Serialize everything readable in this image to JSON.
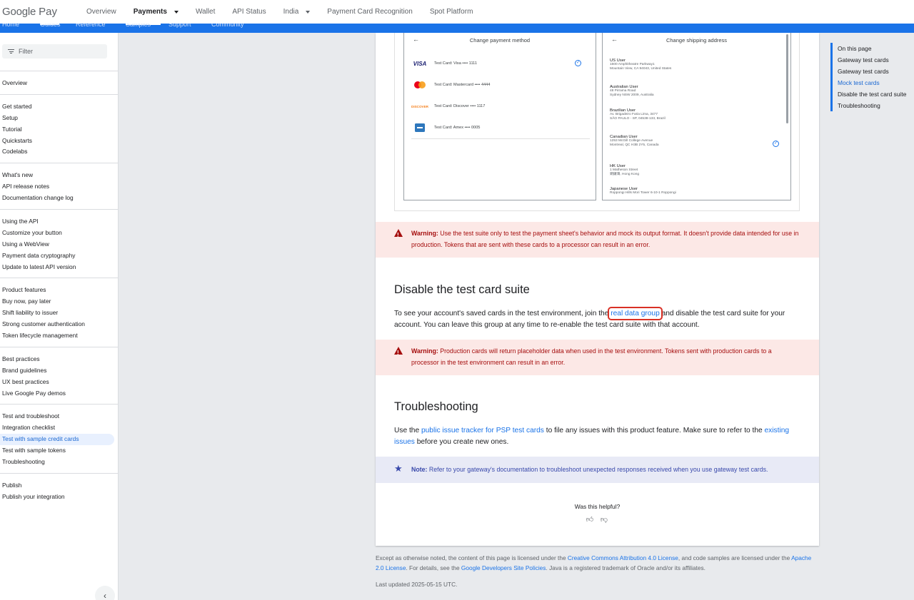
{
  "header": {
    "logo_google": "Google",
    "logo_pay": "Pay",
    "nav": [
      {
        "label": "Overview",
        "active": false,
        "dropdown": false
      },
      {
        "label": "Payments",
        "active": true,
        "dropdown": true
      },
      {
        "label": "Wallet",
        "active": false,
        "dropdown": false
      },
      {
        "label": "API Status",
        "active": false,
        "dropdown": false
      },
      {
        "label": "India",
        "active": false,
        "dropdown": true
      },
      {
        "label": "Payment Card Recognition",
        "active": false,
        "dropdown": false
      },
      {
        "label": "Spot Platform",
        "active": false,
        "dropdown": false
      }
    ],
    "subtabs": [
      "Home",
      "Guides",
      "Reference",
      "Samples",
      "Support",
      "Community"
    ]
  },
  "sidebar": {
    "filter_placeholder": "Filter",
    "groups": [
      {
        "items": [
          "Overview"
        ]
      },
      {
        "heading": "Get started",
        "items": [
          "Setup",
          "Tutorial",
          "Quickstarts",
          "Codelabs"
        ]
      },
      {
        "heading": "What's new",
        "items": [
          "API release notes",
          "Documentation change log"
        ]
      },
      {
        "heading": "Using the API",
        "items": [
          "Customize your button",
          "Using a WebView",
          "Payment data cryptography",
          "Update to latest API version"
        ]
      },
      {
        "heading": "Product features",
        "items": [
          "Buy now, pay later",
          "Shift liability to issuer",
          "Strong customer authentication",
          "Token lifecycle management"
        ]
      },
      {
        "heading": "Best practices",
        "items": [
          "Brand guidelines",
          "UX best practices",
          "Live Google Pay demos"
        ]
      },
      {
        "heading": "Test and troubleshoot",
        "items": [
          "Integration checklist",
          "Test with sample credit cards",
          "Test with sample tokens",
          "Troubleshooting"
        ],
        "selected": "Test with sample credit cards"
      },
      {
        "heading": "Publish",
        "items": [
          "Publish your integration"
        ]
      }
    ],
    "collapse_icon": "chevron-left-icon"
  },
  "figure": {
    "left_title": "Change payment method",
    "right_title": "Change shipping address",
    "cards": [
      {
        "brand": "VISA",
        "text": "Test Card: Visa •••• 1111",
        "color": "#1a1f71",
        "checked": true
      },
      {
        "brand": "MC",
        "text": "Test Card: Mastercard •••• 4444",
        "color": "#eb001b",
        "checked": false
      },
      {
        "brand": "DISCOVER",
        "text": "Test Card: Discover •••• 1117",
        "color": "#f58220",
        "checked": false
      },
      {
        "brand": "AMEX",
        "text": "Test Card: Amex •••• 0005",
        "color": "#2e77bc",
        "checked": false
      }
    ],
    "addresses": [
      {
        "name": "US User",
        "lines": [
          "1600 Amphitheatre Parkway1",
          "Mountain View, CA 94043, United States"
        ]
      },
      {
        "name": "Australian User",
        "lines": [
          "48 Pirrama Road",
          "Sydney NSW 2009, Australia"
        ]
      },
      {
        "name": "Brazilian User",
        "lines": [
          "Av. Brigadeiro Faria Lima, 3477",
          "SÃO PAULO - SP, 04538-133, Brazil"
        ]
      },
      {
        "name": "Canadian User",
        "lines": [
          "1253 McGill College Avenue",
          "Montreal, QC H3B 2Y5, Canada"
        ],
        "checked": true
      },
      {
        "name": "HK User",
        "lines": [
          "1 Matheson Street",
          "銅鑼灣, Hong Kong"
        ]
      },
      {
        "name": "Japanese User",
        "lines": [
          "Roppongi Hills Mori Tower 6-10-1 Roppongi"
        ]
      }
    ]
  },
  "warning1": {
    "label": "Warning:",
    "text": " Use the test suite only to test the payment sheet's behavior and mock its output format. It doesn't provide data intended for use in production. Tokens that are sent with these cards to a processor can result in an error."
  },
  "section_disable": {
    "title": "Disable the test card suite",
    "text_before": "To see your account's saved cards in the test environment, join the ",
    "link": "real data group",
    "text_after": " and disable the test card suite for your account. You can leave this group at any time to re-enable the test card suite with that account."
  },
  "warning2": {
    "label": "Warning:",
    "text": " Production cards will return placeholder data when used in the test environment. Tokens sent with production cards to a processor in the test environment can result in an error."
  },
  "section_trouble": {
    "title": "Troubleshooting",
    "text1": "Use the ",
    "link1": "public issue tracker for PSP test cards",
    "text2": " to file any issues with this product feature. Make sure to refer to the ",
    "link2": "existing issues",
    "text3": " before you create new ones."
  },
  "note": {
    "label": "Note:",
    "text": " Refer to your gateway's documentation to troubleshoot unexpected responses received when you use gateway test cards."
  },
  "feedback": {
    "question": "Was this helpful?",
    "up_icon": "thumb-up-icon",
    "down_icon": "thumb-down-icon"
  },
  "footer": {
    "t1": "Except as otherwise noted, the content of this page is licensed under the ",
    "l1": "Creative Commons Attribution 4.0 License",
    "t2": ", and code samples are licensed under the ",
    "l2": "Apache 2.0 License",
    "t3": ". For details, see the ",
    "l3": "Google Developers Site Policies",
    "t4": ". Java is a registered trademark of Oracle and/or its affiliates.",
    "updated": "Last updated 2025-05-15 UTC."
  },
  "toc": {
    "heading": "On this page",
    "items": [
      "Gateway test cards",
      "Gateway test cards",
      "Mock test cards",
      "Disable the test card suite",
      "Troubleshooting"
    ],
    "current": "Mock test cards"
  },
  "colors": {
    "accent": "#1a73e8",
    "warning_bg": "#fce8e6",
    "warning_text": "#a50e0e",
    "note_bg": "#e8eaf6",
    "highlight_box": "#d93025"
  }
}
